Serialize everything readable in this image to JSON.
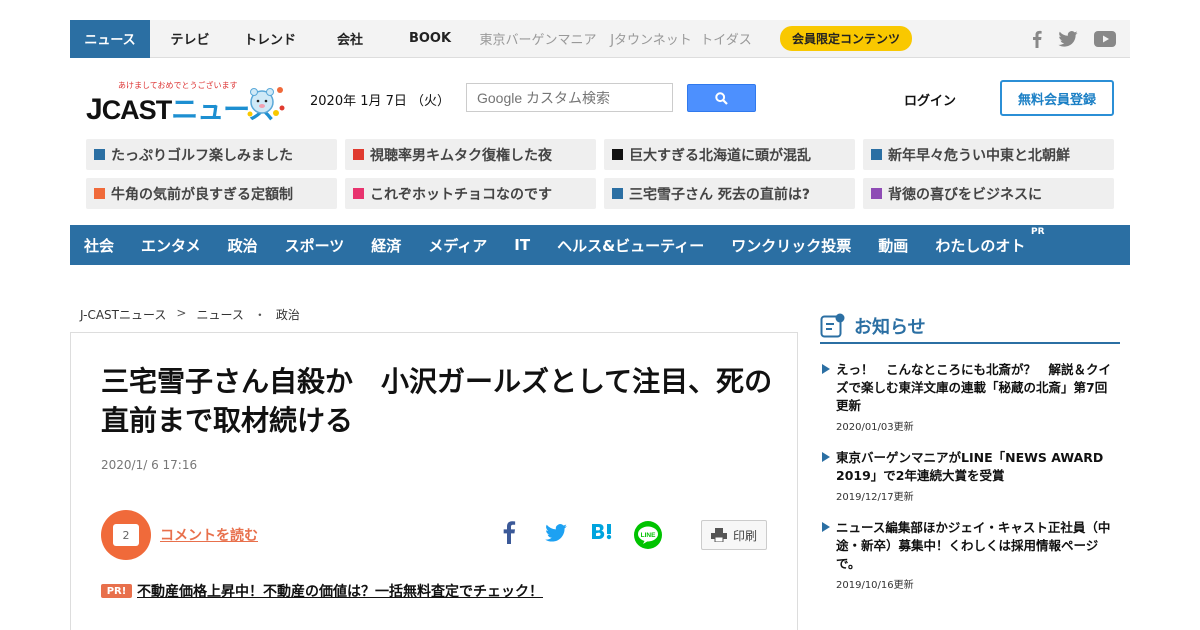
{
  "topnav": {
    "items": [
      "ニュース",
      "テレビ",
      "トレンド",
      "会社",
      "BOOK",
      "東京バーゲンマニア",
      "Jタウンネット",
      "トイダス"
    ],
    "members_badge": "会員限定コンテンツ",
    "social_icons": [
      "facebook-icon",
      "twitter-icon",
      "youtube-icon"
    ]
  },
  "header": {
    "logo_tagline": "あけましておめでとうございます",
    "logo_j": "J",
    "logo_cast": "CAST",
    "logo_news": "ニュース",
    "date": "2020年 1月 7日 （火）",
    "search_placeholder": "Google カスタム検索",
    "login": "ログイン",
    "signup": "無料会員登録"
  },
  "trending": [
    {
      "label": "たっぷりゴルフ楽しみました",
      "color": "#2b6fa3"
    },
    {
      "label": "視聴率男キムタク復権した夜",
      "color": "#e03a2f"
    },
    {
      "label": "巨大すぎる北海道に頭が混乱",
      "color": "#111111"
    },
    {
      "label": "新年早々危うい中東と北朝鮮",
      "color": "#2b6fa3"
    },
    {
      "label": "牛角の気前が良すぎる定額制",
      "color": "#f06a3a"
    },
    {
      "label": "これぞホットチョコなのです",
      "color": "#e8336e"
    },
    {
      "label": "三宅雪子さん 死去の直前は?",
      "color": "#2b6fa3"
    },
    {
      "label": "背徳の喜びをビジネスに",
      "color": "#8e4bb5"
    }
  ],
  "categories": [
    "社会",
    "エンタメ",
    "政治",
    "スポーツ",
    "経済",
    "メディア",
    "IT",
    "ヘルス&ビューティー",
    "ワンクリック投票",
    "動画",
    "わたしのオト"
  ],
  "categories_pr": "PR",
  "breadcrumb": {
    "home": "J-CASTニュース",
    "sep1": ">",
    "section": "ニュース",
    "sep2": "・",
    "category": "政治"
  },
  "article": {
    "headline": "三宅雪子さん自殺か　小沢ガールズとして注目、死の直前まで取材続ける",
    "timestamp": "2020/1/ 6 17:16",
    "comment_count": "2",
    "comment_link": "コメントを読む",
    "print_label": "印刷",
    "pr_badge": "PR!",
    "pr_link": "不動産価格上昇中！不動産の価値は？一括無料査定でチェック！"
  },
  "sidebar": {
    "title": "お知らせ",
    "notices": [
      {
        "text": "えっ！　こんなところにも北斎が？　解説＆クイズで楽しむ東洋文庫の連載「秘蔵の北斎」第7回更新",
        "updated": "2020/01/03更新"
      },
      {
        "text": "東京バーゲンマニアがLINE「NEWS AWARD 2019」で2年連続大賞を受賞",
        "updated": "2019/12/17更新"
      },
      {
        "text": "ニュース編集部ほかジェイ・キャスト正社員（中途・新卒）募集中！くわしくは採用情報ページで。",
        "updated": "2019/10/16更新"
      }
    ]
  },
  "colors": {
    "brand_blue": "#2b6fa3",
    "accent_orange": "#f06a3a",
    "badge_yellow": "#f9c800"
  }
}
